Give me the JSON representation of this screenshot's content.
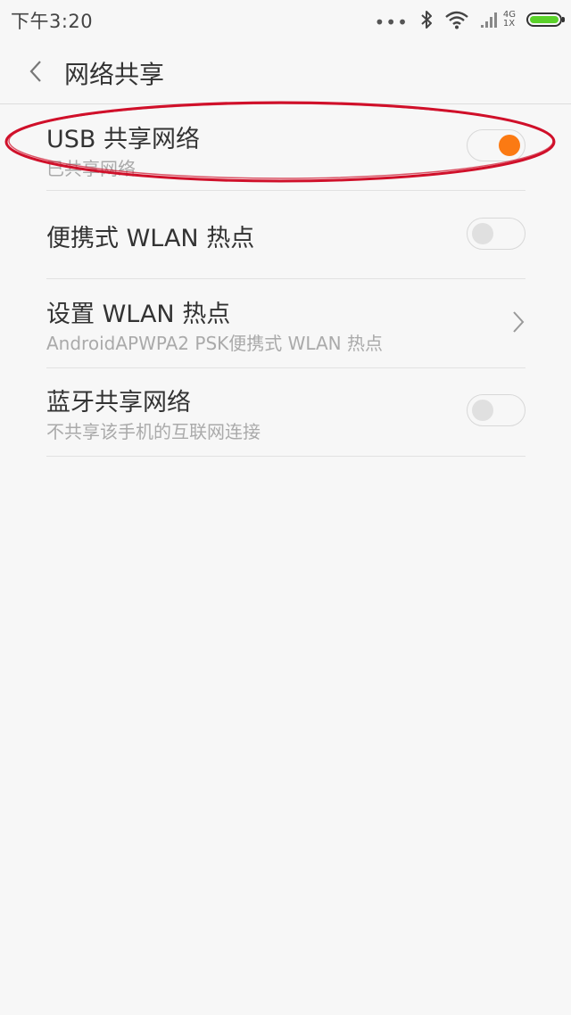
{
  "status_bar": {
    "time": "下午3:20",
    "dots": "•••",
    "network_type_top": "4G",
    "network_type_bottom": "1X",
    "icons": [
      "bluetooth-icon",
      "wifi-icon",
      "signal-icon",
      "battery-icon"
    ],
    "battery_color": "#5ad12a"
  },
  "title_bar": {
    "title": "网络共享",
    "back_icon": "chevron-left-icon"
  },
  "settings": [
    {
      "title": "USB 共享网络",
      "subtitle": "已共享网络",
      "control": "toggle",
      "enabled": true
    },
    {
      "title": "便携式 WLAN 热点",
      "control": "toggle",
      "enabled": false
    },
    {
      "title": "设置 WLAN 热点",
      "subtitle": "AndroidAPWPA2 PSK便携式 WLAN 热点",
      "control": "chevron-right-icon"
    },
    {
      "title": "蓝牙共享网络",
      "subtitle": "不共享该手机的互联网连接",
      "control": "toggle",
      "enabled": false
    }
  ],
  "colors": {
    "accent": "#fb7a13",
    "annotation": "#d0102a",
    "background": "#f7f7f7"
  }
}
